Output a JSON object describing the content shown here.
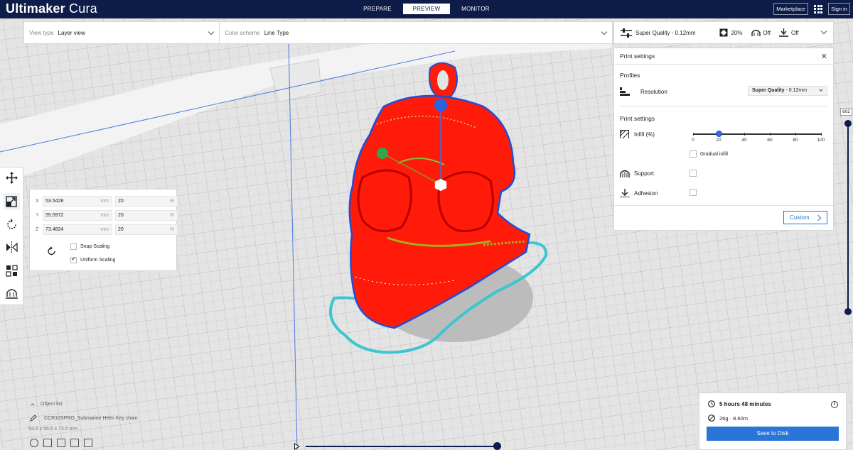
{
  "app": {
    "brand_bold": "Ultimaker",
    "brand_light": "Cura"
  },
  "stages": [
    {
      "label": "PREPARE",
      "active": false
    },
    {
      "label": "PREVIEW",
      "active": true
    },
    {
      "label": "MONITOR",
      "active": false
    }
  ],
  "top_right": {
    "marketplace": "Marketplace",
    "signin": "Sign in"
  },
  "header": {
    "view_type_label": "View type",
    "view_type_value": "Layer view",
    "color_scheme_label": "Color scheme",
    "color_scheme_value": "Line Type"
  },
  "quality_bar": {
    "profile": "Super Quality - 0.12mm",
    "infill": "20%",
    "support": "Off",
    "adhesion": "Off"
  },
  "print_panel": {
    "title": "Print settings",
    "profiles_label": "Profiles",
    "resolution_label": "Resolution",
    "resolution_value_bold": "Super Quality",
    "resolution_value_rest": " - 0.12mm",
    "settings_label": "Print settings",
    "infill_label": "Infill (%)",
    "infill_value": 20,
    "infill_ticks": [
      "0",
      "20",
      "40",
      "60",
      "80",
      "100"
    ],
    "gradual_infill_label": "Gradual infill",
    "gradual_infill": false,
    "support_label": "Support",
    "support_checked": false,
    "adhesion_label": "Adhesion",
    "adhesion_checked": false,
    "custom_button": "Custom"
  },
  "scale_panel": {
    "rows": [
      {
        "axis": "X",
        "mm": "53.5428",
        "mm_unit": "mm",
        "pct": "20",
        "pct_unit": "%"
      },
      {
        "axis": "Y",
        "mm": "55.5972",
        "mm_unit": "mm",
        "pct": "20",
        "pct_unit": "%"
      },
      {
        "axis": "Z",
        "mm": "73.4824",
        "mm_unit": "mm",
        "pct": "20",
        "pct_unit": "%"
      }
    ],
    "snap_scaling_label": "Snap Scaling",
    "snap_scaling": false,
    "uniform_scaling_label": "Uniform Scaling",
    "uniform_scaling": true
  },
  "layer_slider": {
    "current_layer": "602"
  },
  "object_list": {
    "title": "Object list",
    "object_name": "CCR10SPRO_Submarine Helm Key chain",
    "dimensions": "53.5 x 55.6 x 73.5 mm"
  },
  "job": {
    "print_time": "5 hours 48 minutes",
    "material": "26g · 8.60m",
    "save_button": "Save to Disk"
  },
  "colors": {
    "topbar": "#0d1c49",
    "accent": "#2a75d6",
    "model_red": "#ff1a0a",
    "skirt_cyan": "#3cc6cf"
  }
}
